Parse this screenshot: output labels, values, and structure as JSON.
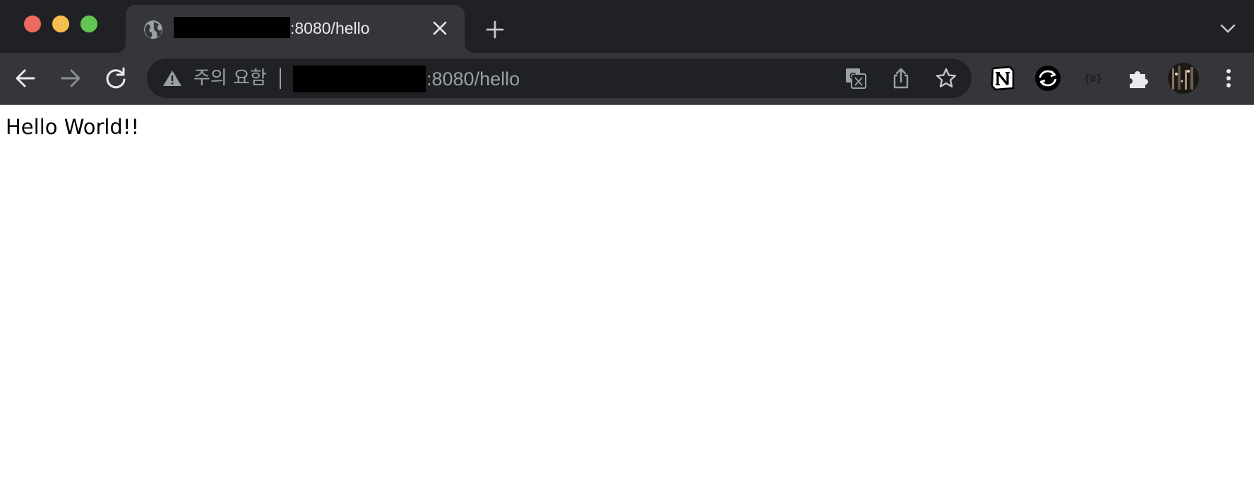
{
  "window": {
    "controls": {
      "close_color": "#ed6a5e",
      "minimize_color": "#f5bf4f",
      "maximize_color": "#61c554"
    }
  },
  "tab": {
    "icon": "globe-icon",
    "title": ":8080/hello",
    "close_icon": "close-icon"
  },
  "tabstrip": {
    "new_tab_icon": "plus-icon",
    "tab_search_icon": "chevron-down-icon"
  },
  "toolbar": {
    "back_icon": "arrow-left-icon",
    "forward_icon": "arrow-right-icon",
    "reload_icon": "reload-icon",
    "omnibox": {
      "security_icon": "warning-icon",
      "security_label": "주의 요함",
      "url": ":8080/hello",
      "translate_icon": "translate-icon",
      "share_icon": "share-icon",
      "bookmark_icon": "star-icon"
    },
    "extensions": [
      {
        "name": "notion",
        "icon": "notion-icon"
      },
      {
        "name": "sync",
        "icon": "sync-icon"
      },
      {
        "name": "json-viewer",
        "icon": "json-braces-icon",
        "label": "{≡}"
      },
      {
        "name": "extensions",
        "icon": "puzzle-icon"
      }
    ],
    "avatar_icon": "profile-avatar",
    "menu_icon": "more-vert-icon"
  },
  "page": {
    "text": "Hello World!!"
  },
  "colors": {
    "tabstrip_bg": "#202124",
    "active_tab_bg": "#35363a",
    "omnibox_bg": "#202124",
    "muted_text": "#9aa0a6",
    "light_text": "#e8eaed",
    "page_bg": "#ffffff"
  }
}
